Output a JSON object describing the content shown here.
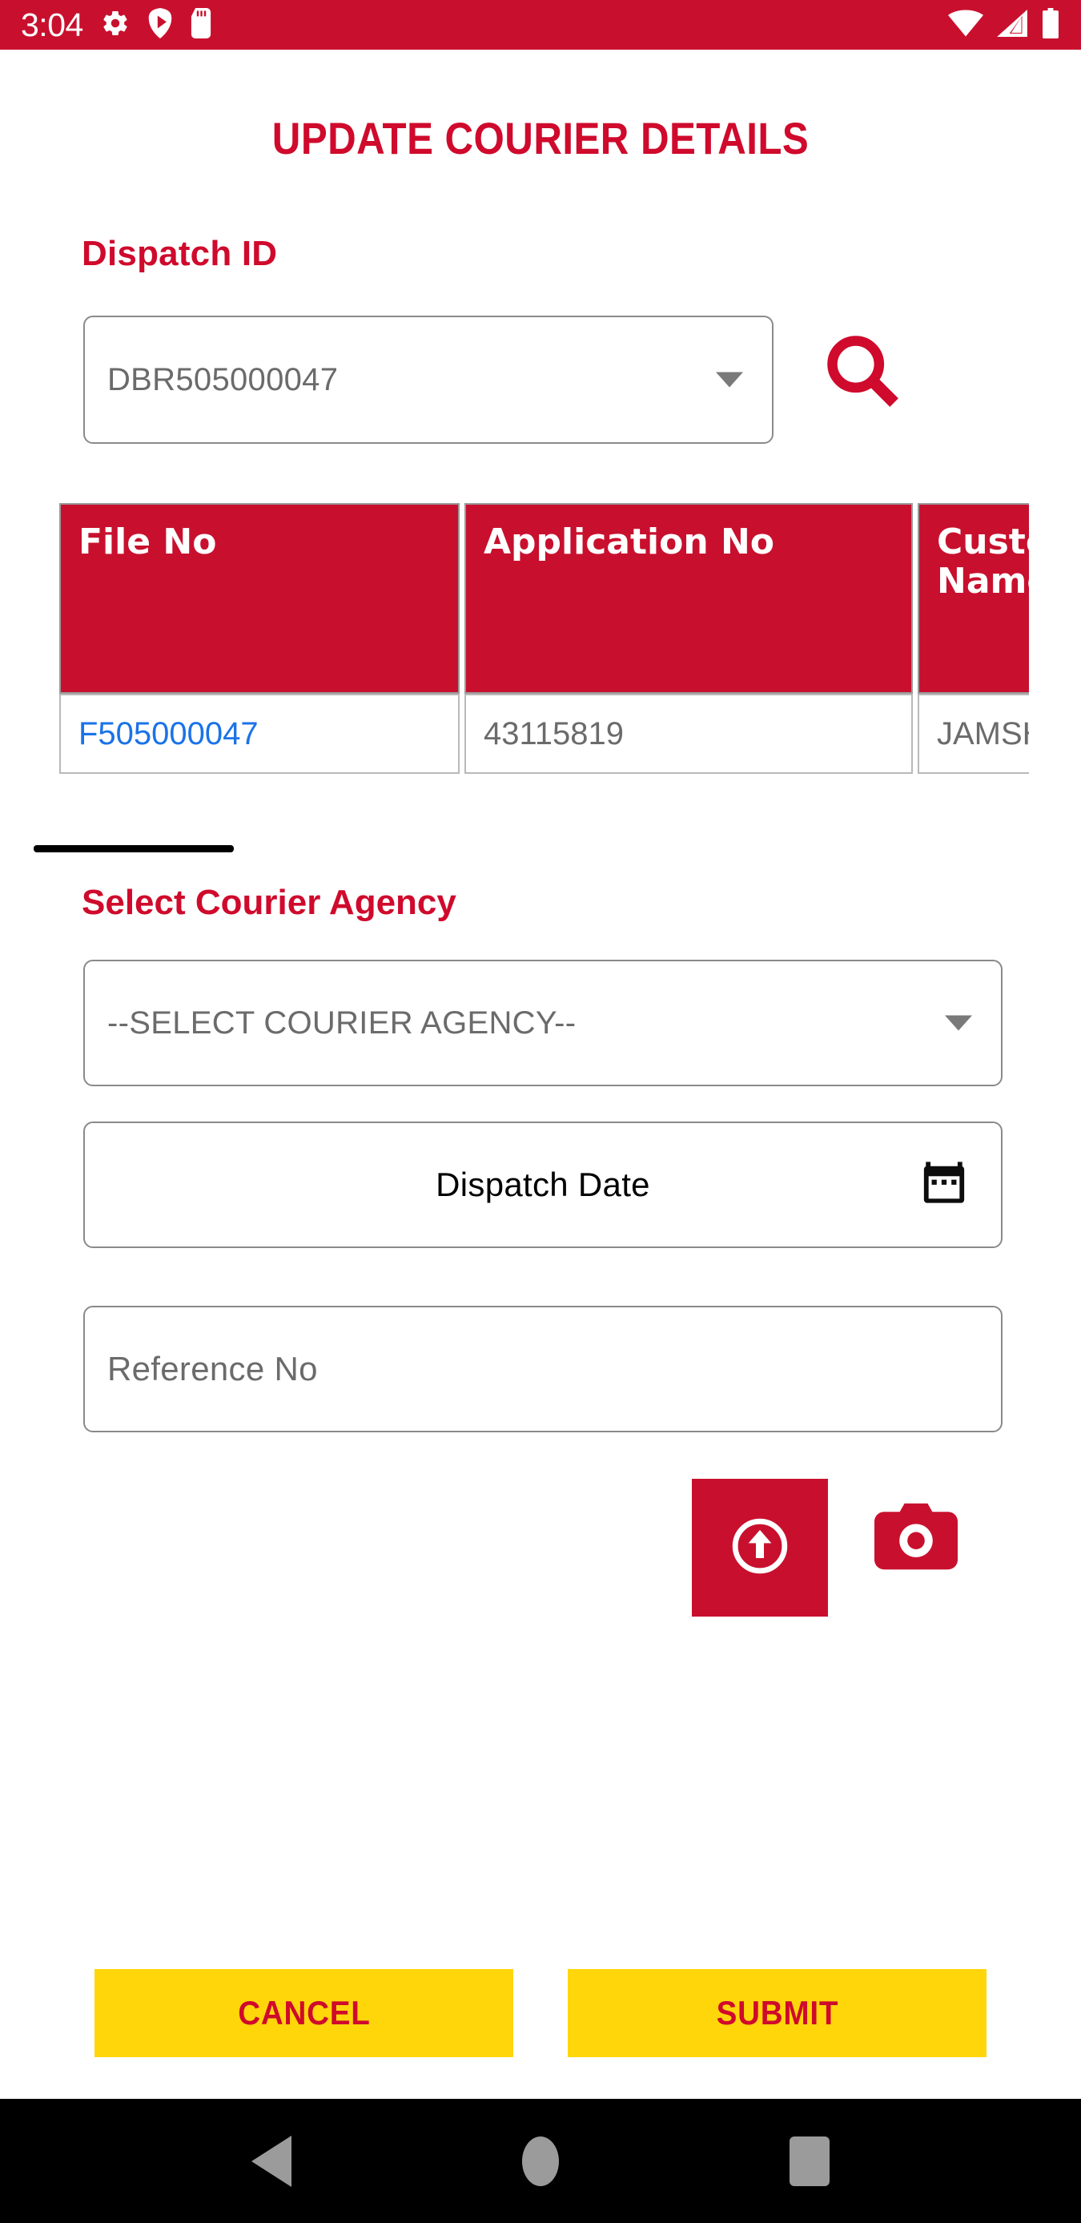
{
  "status_bar": {
    "clock": "3:04",
    "left_icons": [
      "gear-icon",
      "play-icon",
      "sd-card-icon"
    ],
    "right_icons": [
      "wifi-icon",
      "cellular-signal-icon",
      "battery-icon"
    ],
    "background_color": "#c8102e",
    "icon_color": "#ffffff"
  },
  "header": {
    "title": "UPDATE COURIER DETAILS",
    "title_color": "#cf0a2c"
  },
  "dispatch": {
    "label": "Dispatch ID",
    "selected_value": "DBR505000047",
    "search_icon": "search-icon"
  },
  "table": {
    "headers": [
      "File No",
      "Application No",
      "Customer Name"
    ],
    "rows": [
      [
        "F505000047",
        "43115819",
        "JAMSHED"
      ]
    ],
    "header_bg": "#c8102e",
    "link_color": "#1a73e8",
    "scroll_position": "left"
  },
  "agency": {
    "label": "Select Courier Agency",
    "selected_value": "--SELECT COURIER AGENCY--"
  },
  "dispatch_date": {
    "label": "Dispatch Date",
    "value": "",
    "calendar_icon": "calendar-icon"
  },
  "reference": {
    "placeholder": "Reference No",
    "value": ""
  },
  "media": {
    "upload_icon": "upload-circle-arrow-icon",
    "camera_icon": "camera-icon",
    "upload_bg": "#c8102e",
    "camera_color": "#c8102e"
  },
  "footer": {
    "cancel_label": "CANCEL",
    "submit_label": "SUBMIT",
    "button_bg": "#ffd60a",
    "button_text_color": "#cf0a2c"
  },
  "nav_bar": {
    "back_icon": "back-triangle-icon",
    "home_icon": "home-circle-icon",
    "recents_icon": "recents-square-icon",
    "background_color": "#000000",
    "icon_color": "#9b9b9b"
  }
}
